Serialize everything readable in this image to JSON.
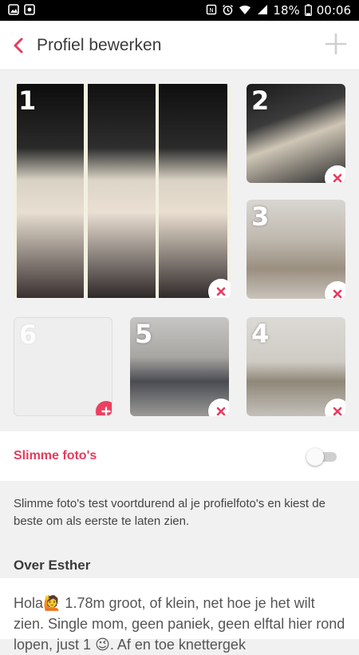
{
  "status_bar": {
    "battery": "18%",
    "time": "00:06"
  },
  "header": {
    "title": "Profiel bewerken"
  },
  "photos": [
    {
      "number": "1",
      "state": "filled",
      "action": "remove"
    },
    {
      "number": "2",
      "state": "filled",
      "action": "remove"
    },
    {
      "number": "3",
      "state": "filled",
      "action": "remove"
    },
    {
      "number": "4",
      "state": "filled",
      "action": "remove"
    },
    {
      "number": "5",
      "state": "filled",
      "action": "remove"
    },
    {
      "number": "6",
      "state": "empty",
      "action": "add"
    }
  ],
  "smart_photos": {
    "label": "Slimme foto's",
    "enabled": false,
    "description": "Slimme foto's test voortdurend al je profielfoto's en kiest de beste om als eerste te laten zien."
  },
  "about": {
    "title": "Over Esther",
    "text": "Hola🙋 1.78m groot, of klein, net hoe je het wilt zien. Single mom, geen paniek, geen elftal hier rond lopen, just 1 😉. Af en toe knettergek"
  },
  "colors": {
    "accent": "#e83b5d",
    "background": "#f1f1f1"
  }
}
